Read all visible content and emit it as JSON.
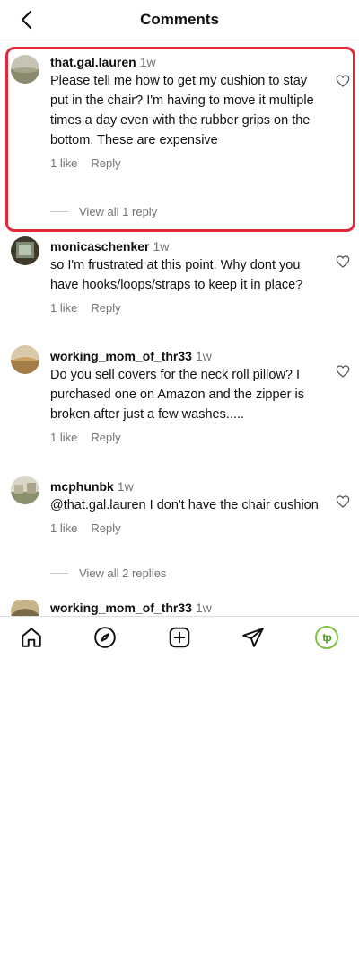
{
  "header": {
    "title": "Comments"
  },
  "comments": [
    {
      "user": "that.gal.lauren",
      "time": "1w",
      "text": "Please tell me how to get my cushion to stay put in the chair? I'm having to move it multiple times a day even with the rubber grips on the bottom. These are expensive",
      "likes": "1 like",
      "reply": "Reply",
      "view_replies": "View all 1 reply"
    },
    {
      "user": "monicaschenker",
      "time": "1w",
      "text": "so I'm frustrated at this point. Why dont you have hooks/loops/straps to keep it in place?",
      "likes": "1 like",
      "reply": "Reply"
    },
    {
      "user": "working_mom_of_thr33",
      "time": "1w",
      "text": "Do you sell covers for the neck roll pillow? I purchased one on Amazon and the zipper is broken after just a few washes.....",
      "likes": "1 like",
      "reply": "Reply"
    },
    {
      "user": "mcphunbk",
      "time": "1w",
      "text": "@that.gal.lauren I don't have the chair cushion",
      "likes": "1 like",
      "reply": "Reply",
      "view_replies": "View all 2 replies"
    },
    {
      "user": "working_mom_of_thr33",
      "time": "1w"
    }
  ],
  "nav": {
    "items": [
      "home-icon",
      "explore-icon",
      "create-icon",
      "direct-icon",
      "profile-avatar"
    ],
    "profile_text": "tp"
  },
  "colors": {
    "highlight": "#e02a3a",
    "muted": "#737373",
    "brand_green": "#7cc242"
  }
}
